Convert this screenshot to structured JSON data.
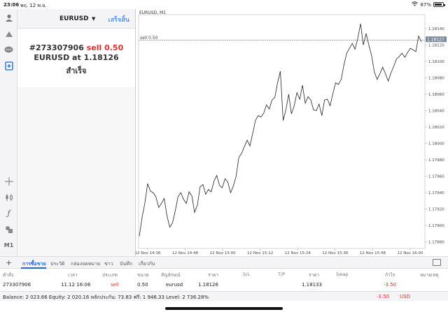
{
  "status_bar": {
    "time": "23:06",
    "date": "พฤ. 12 พ.ย.",
    "battery": "87%",
    "battery_level": 0.87
  },
  "trade_panel": {
    "symbol": "EURUSD",
    "done_label": "เสร็จสิ้น",
    "order_id": "#273307906",
    "order_side_volume": "sell 0.50",
    "order_symbol_at": "EURUSD at",
    "order_price": "1.18126",
    "result": "สำเร็จ"
  },
  "toolbar": {
    "timeframe_label": "M1"
  },
  "chart": {
    "title": "EURUSD, M1",
    "order_line_label": "sell 0.50",
    "current_price_badge": "1.18127"
  },
  "chart_data": {
    "type": "line",
    "symbol": "EURUSD",
    "timeframe": "M1",
    "x_tick_labels": [
      "12 Nov 14:36",
      "12 Nov 14:48",
      "12 Nov 15:00",
      "12 Nov 15:12",
      "12 Nov 15:24",
      "12 Nov 15:36",
      "12 Nov 15:48",
      "12 Nov 16:00"
    ],
    "y_tick_labels": [
      "1.18140",
      "1.18120",
      "1.18100",
      "1.18080",
      "1.18060",
      "1.18040",
      "1.18020",
      "1.18000",
      "1.17980",
      "1.17960",
      "1.17940",
      "1.17920",
      "1.17900",
      "1.17880"
    ],
    "ylim": [
      1.17872,
      1.18157
    ],
    "order_line_value": 1.18126,
    "values": [
      1.17887,
      1.1791,
      1.17927,
      1.17951,
      1.17942,
      1.1794,
      1.17935,
      1.17922,
      1.17927,
      1.17933,
      1.17912,
      1.17898,
      1.17903,
      1.17918,
      1.17935,
      1.1794,
      1.17932,
      1.17927,
      1.17941,
      1.17936,
      1.17916,
      1.17925,
      1.17947,
      1.1795,
      1.17938,
      1.17944,
      1.17941,
      1.17954,
      1.17961,
      1.17949,
      1.17946,
      1.17957,
      1.17953,
      1.1794,
      1.17948,
      1.1796,
      1.17983,
      1.17988,
      1.17996,
      1.18004,
      1.17997,
      1.18012,
      1.18028,
      1.18034,
      1.18032,
      1.18037,
      1.18047,
      1.18042,
      1.18053,
      1.18056,
      1.18074,
      1.18088,
      1.18028,
      1.18041,
      1.1806,
      1.18036,
      1.18046,
      1.18062,
      1.18054,
      1.18071,
      1.18049,
      1.18057,
      1.18053,
      1.18041,
      1.1804,
      1.18048,
      1.18034,
      1.18053,
      1.18054,
      1.18046,
      1.18061,
      1.18074,
      1.18072,
      1.18078,
      1.18096,
      1.1811,
      1.18116,
      1.18122,
      1.18115,
      1.18128,
      1.18146,
      1.1812,
      1.18134,
      1.1812,
      1.18107,
      1.18087,
      1.18078,
      1.18085,
      1.18093,
      1.18085,
      1.18076,
      1.18086,
      1.18094,
      1.18103,
      1.18106,
      1.1811,
      1.18105,
      1.18111,
      1.18116,
      1.18114,
      1.18112,
      1.18131,
      1.18124
    ]
  },
  "tabs": {
    "items": [
      "การซื้อขาย",
      "ประวัติ",
      "กล่องจดหมาย",
      "ข่าว",
      "บันทึก",
      "เกี่ยวกับ"
    ],
    "active_index": 0
  },
  "positions_table": {
    "headers": [
      "คำสั่ง",
      "เวลา",
      "ประเภท",
      "ขนาด",
      "สัญลักษณ์",
      "ราคา",
      "S/L",
      "T/P",
      "ราคา",
      "Swap",
      "กำไร",
      "หมายเหตุ"
    ],
    "rows": [
      {
        "order": "273307906",
        "time": "11.12 16:06",
        "type": "sell",
        "size": "0.50",
        "symbol": "eurusd",
        "price": "1.18126",
        "sl": "",
        "tp": "",
        "current_price": "1.18133",
        "swap": "",
        "profit": "-3.50",
        "comment": ""
      }
    ]
  },
  "footer": {
    "balance_line": "Balance: 2 023.66 Equity: 2 020.16 หลักประกัน: 73.83 ฟรี: 1 946.33 Level: 2 736.28%",
    "total_profit": "-3.50",
    "currency": "USD"
  },
  "colors": {
    "accent": "#1b6ad8",
    "loss": "#d9312a"
  }
}
